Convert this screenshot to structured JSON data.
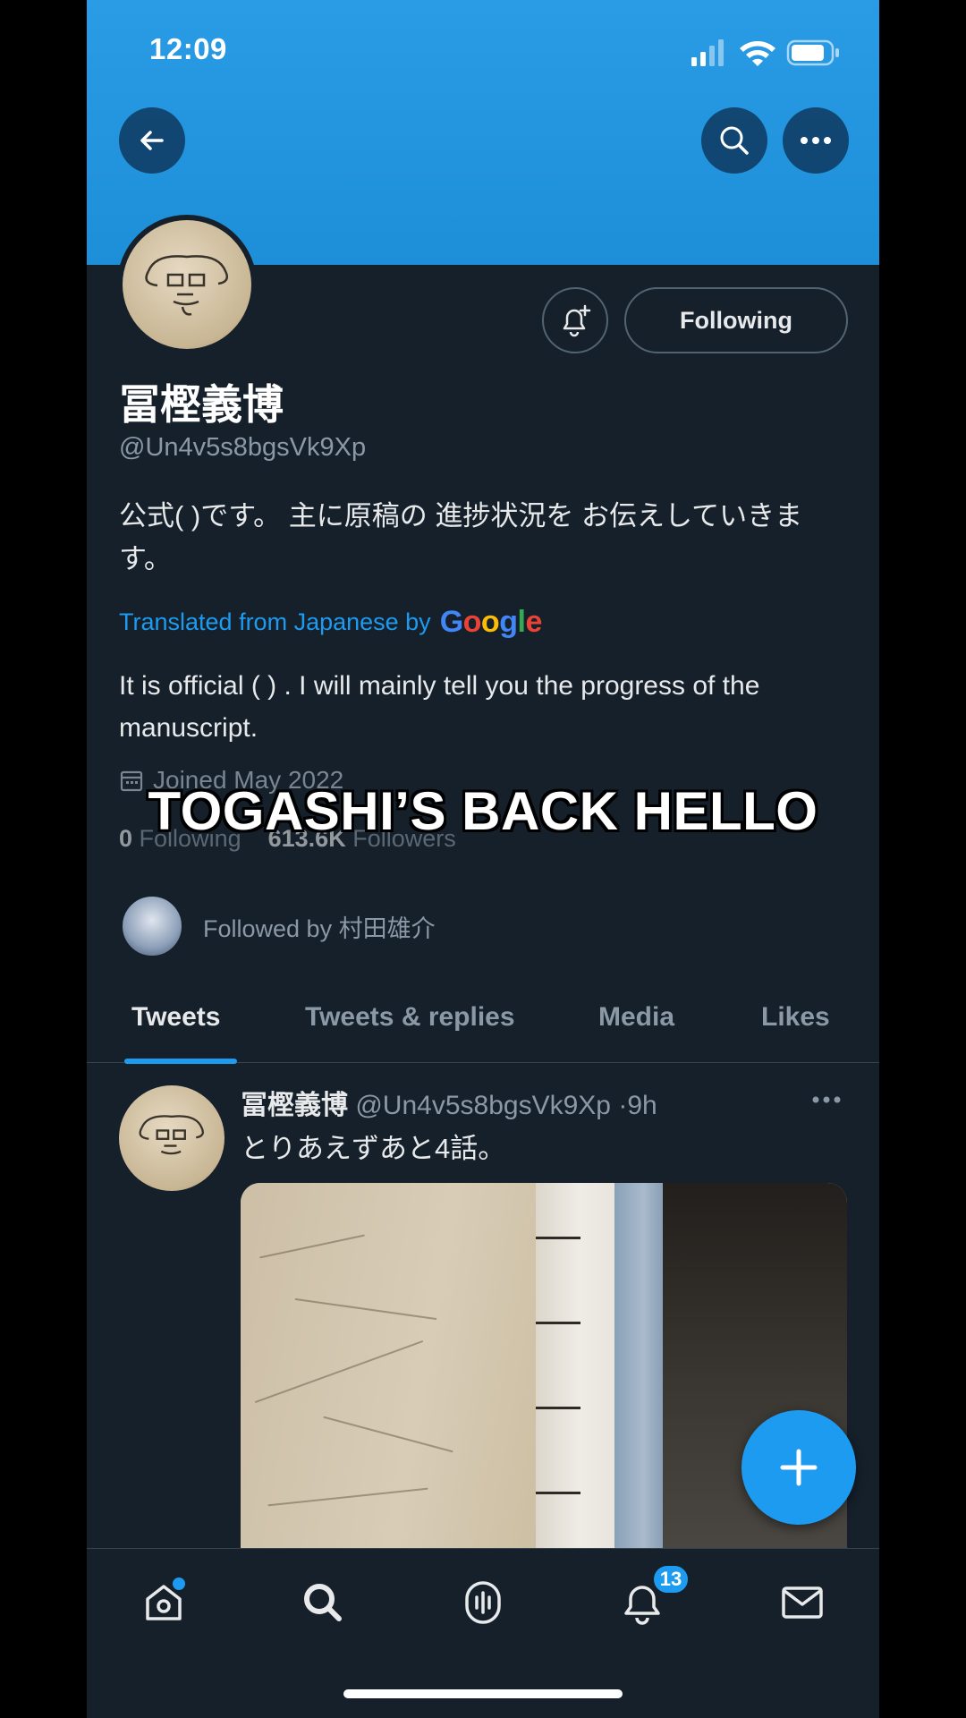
{
  "status_bar": {
    "time": "12:09"
  },
  "profile": {
    "display_name": "冨樫義博",
    "handle": "@Un4v5s8bgsVk9Xp",
    "bio": "公式( )です。 主に原稿の 進捗状況を お伝えしていきます。",
    "translated_label": "Translated from Japanese by",
    "translator": "Google",
    "bio_translated": "It is official ( ) . I will mainly tell you the progress of the manuscript.",
    "joined": "Joined May 2022",
    "following_count": "0",
    "following_label": "Following",
    "followers_count": "613.6K",
    "followers_label": "Followers",
    "followed_by": "Followed by 村田雄介",
    "following_button": "Following"
  },
  "overlay_caption": "TOGASHI’S BACK HELLO",
  "tabs": [
    {
      "label": "Tweets",
      "active": true
    },
    {
      "label": "Tweets & replies",
      "active": false
    },
    {
      "label": "Media",
      "active": false
    },
    {
      "label": "Likes",
      "active": false
    }
  ],
  "tweet": {
    "name": "冨樫義博",
    "handle": "@Un4v5s8bgsVk9Xp",
    "time": "9h",
    "text": "とりあえずあと4話。"
  },
  "bottom_nav": {
    "notifications_badge": "13"
  },
  "colors": {
    "accent": "#1d9bf0",
    "background": "#15202b",
    "banner": "#2a9be5",
    "secondary_text": "#8b98a5"
  }
}
